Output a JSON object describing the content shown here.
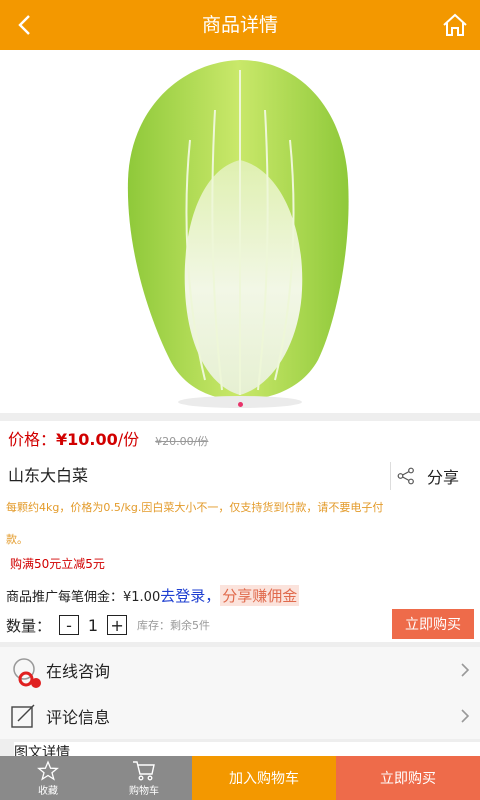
{
  "header": {
    "title": "商品详情"
  },
  "product": {
    "price_label": "价格：",
    "price": "¥10.00",
    "price_unit": "/份",
    "old_price": "¥20.00/份",
    "name": "山东大白菜",
    "share_label": "分享",
    "description": "每颗约4kg，价格为0.5/kg.因白菜大小不一，仅支持货到付款，请不要电子付款。",
    "promo": "购满50元立减5元",
    "commission_prefix": "商品推广每笔佣金：¥1.00",
    "login_link": "去登录",
    "comma": "，",
    "earn_link": "分享赚佣金",
    "qty_label": "数量：",
    "qty_minus": "-",
    "qty_value": "1",
    "qty_plus": "+",
    "stock": "库存：剩余5件",
    "buy_now_small": "立即购买"
  },
  "list": {
    "consult": "在线咨询",
    "reviews": "评论信息",
    "detail_tab": "图文详情"
  },
  "bottom": {
    "favorite": "收藏",
    "cart": "购物车",
    "add_cart": "加入购物车",
    "buy_now": "立即购买"
  },
  "colors": {
    "brand": "#f39800",
    "accent": "#ee6b4a",
    "price": "#d10000"
  },
  "icons": [
    "back-icon",
    "home-icon",
    "share-icon",
    "chat-icon",
    "edit-icon",
    "chevron-right-icon",
    "star-icon",
    "cart-icon"
  ]
}
